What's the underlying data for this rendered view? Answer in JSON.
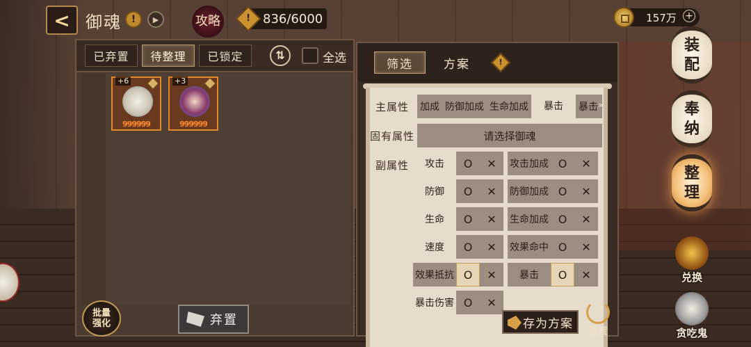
{
  "header": {
    "back_label": "<",
    "title": "御魂",
    "info_icon": "!",
    "guide_label": "攻略",
    "stamina": "836/6000",
    "coins": "157万",
    "plus": "+"
  },
  "left_panel": {
    "tabs": [
      {
        "label": "已弃置"
      },
      {
        "label": "待整理"
      },
      {
        "label": "已锁定"
      }
    ],
    "sort_icon": "⇅",
    "select_all_label": "全选",
    "cards": [
      {
        "level": "+6",
        "stars": "999999"
      },
      {
        "level": "+3",
        "stars": "999999"
      }
    ],
    "bulk_label_1": "批量",
    "bulk_label_2": "强化",
    "discard_label": "弃置"
  },
  "right_panel": {
    "tabs": [
      {
        "label": "筛选"
      },
      {
        "label": "方案"
      }
    ],
    "info_icon": "!",
    "main_attr_label": "主属性",
    "main_attrs": [
      "加成",
      "防御加成",
      "生命加成",
      "暴击",
      "暴击"
    ],
    "main_arrow": "»",
    "fixed_attr_label": "固有属性",
    "fixed_attr_placeholder": "请选择御魂",
    "sub_attr_label": "副属性",
    "circle": "O",
    "cross": "✕",
    "sub_attrs_left": [
      "攻击",
      "防御",
      "生命",
      "速度",
      "效果抵抗",
      "暴击伤害"
    ],
    "sub_attrs_right": [
      "攻击加成",
      "防御加成",
      "生命加成",
      "效果命中",
      "暴击"
    ],
    "save_label": "存为方案",
    "reset_label": "重置"
  },
  "side_menu": {
    "equip": [
      "装",
      "配"
    ],
    "offer": [
      "奉",
      "纳"
    ],
    "organize": [
      "整",
      "理"
    ],
    "exchange_label": "兑换",
    "greedy_label": "贪吃鬼"
  },
  "colors": {
    "accent_orange": "#e08a2a",
    "panel_bg": "#4b3a30",
    "scroll_bg": "#e6dccb"
  }
}
